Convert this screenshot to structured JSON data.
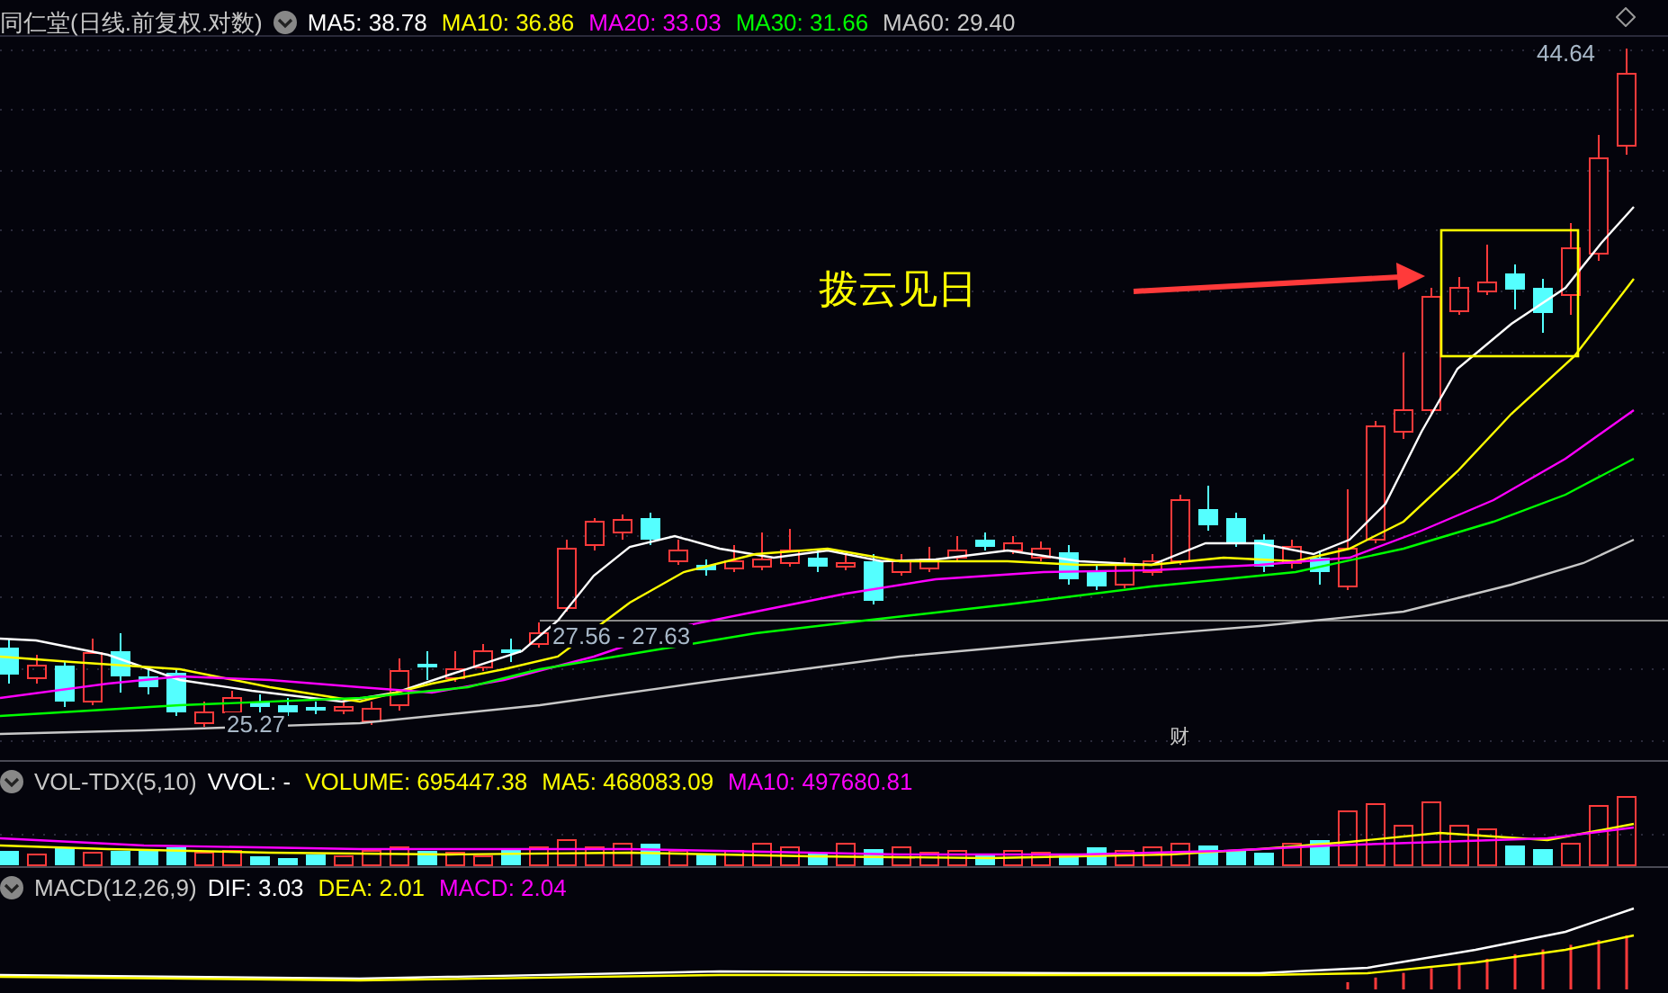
{
  "title": "同仁堂(日线.前复权.对数)",
  "ma_legend": [
    {
      "label": "MA5: 38.78",
      "color": "#ffffff"
    },
    {
      "label": "MA10: 36.86",
      "color": "#ffff00"
    },
    {
      "label": "MA20: 33.03",
      "color": "#ff00ff"
    },
    {
      "label": "MA30: 31.66",
      "color": "#00ff00"
    },
    {
      "label": "MA60: 29.40",
      "color": "#c8c8c8"
    }
  ],
  "price_labels": [
    "44.64",
    "27.56 - 27.63",
    "25.27"
  ],
  "annotation": "拨云见日",
  "marker": "财",
  "volume_panel": {
    "title": "VOL-TDX(5,10)",
    "legend": [
      {
        "label": "VVOL: -",
        "color": "#ffffff"
      },
      {
        "label": "VOLUME: 695447.38",
        "color": "#ffff00"
      },
      {
        "label": "MA5: 468083.09",
        "color": "#ffff00"
      },
      {
        "label": "MA10: 497680.81",
        "color": "#ff00ff"
      }
    ]
  },
  "macd_panel": {
    "title": "MACD(12,26,9)",
    "legend": [
      {
        "label": "DIF: 3.03",
        "color": "#ffffff"
      },
      {
        "label": "DEA: 2.01",
        "color": "#ffff00"
      },
      {
        "label": "MACD: 2.04",
        "color": "#ff00ff"
      }
    ]
  }
}
